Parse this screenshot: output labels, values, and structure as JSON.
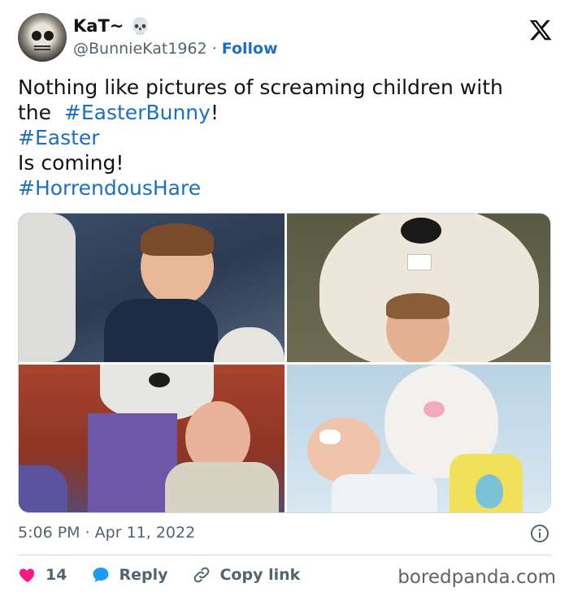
{
  "author": {
    "display_name": "KaT~",
    "name_emoji": "💀",
    "handle": "@BunnieKat1962",
    "separator": "·",
    "follow_label": "Follow"
  },
  "tweet": {
    "line1": "Nothing like pictures of screaming children with",
    "line2_prefix": "the  ",
    "line2_tag": "#EasterBunny",
    "line2_suffix": "!",
    "line3_tag": "#Easter",
    "line4": "Is coming!",
    "line5_tag": "#HorrendousHare"
  },
  "timestamp": "5:06 PM · Apr 11, 2022",
  "actions": {
    "like_count": "14",
    "reply_label": "Reply",
    "copy_link_label": "Copy link"
  },
  "watermark": "boredpanda.com",
  "colors": {
    "link": "#1d6fc4",
    "like": "#f91880",
    "reply": "#1d9bf0",
    "muted": "#536471"
  },
  "icons": [
    "x-logo-icon",
    "info-icon",
    "heart-icon",
    "reply-bubble-icon",
    "link-icon"
  ]
}
